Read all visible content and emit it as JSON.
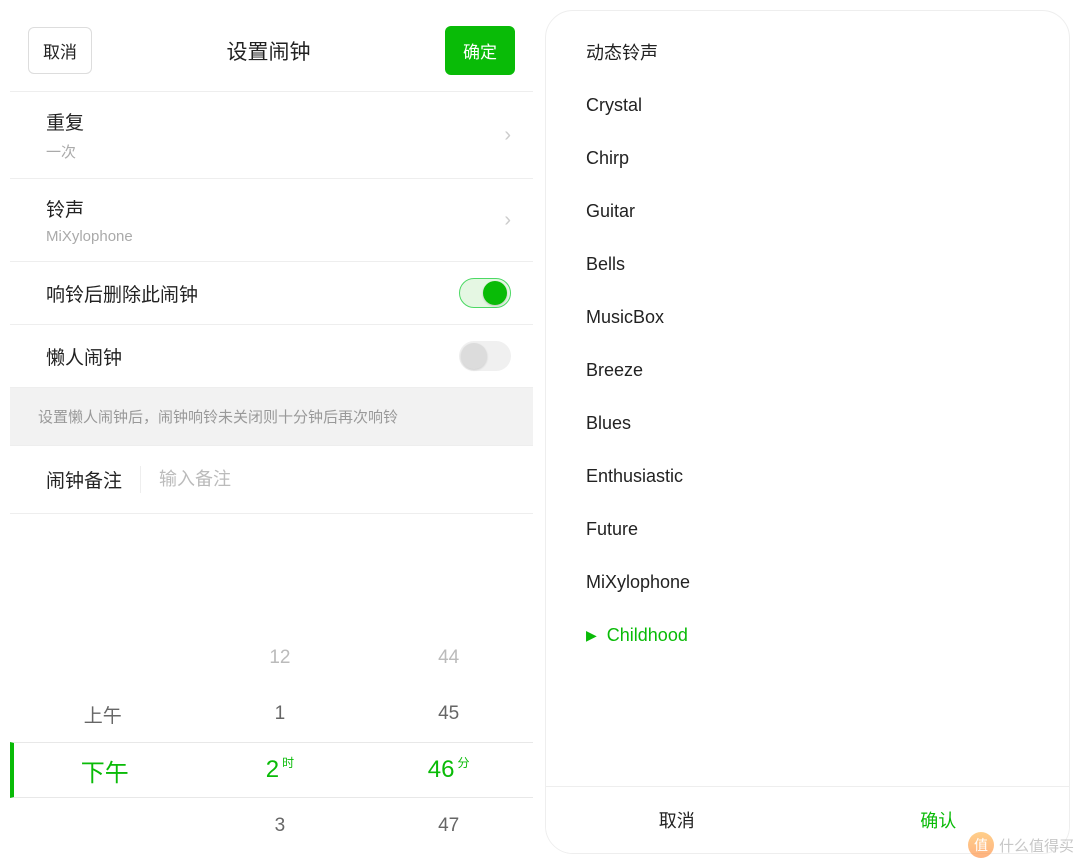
{
  "colors": {
    "accent": "#09bb07"
  },
  "left": {
    "header": {
      "cancel": "取消",
      "title": "设置闹钟",
      "ok": "确定"
    },
    "rows": {
      "repeat": {
        "title": "重复",
        "value": "一次"
      },
      "ringtone": {
        "title": "铃声",
        "value": "MiXylophone"
      },
      "delete_after": {
        "title": "响铃后删除此闹钟",
        "on": true
      },
      "lazy": {
        "title": "懒人闹钟",
        "on": false
      }
    },
    "hint": "设置懒人闹钟后，闹钟响铃未关闭则十分钟后再次响铃",
    "note": {
      "label": "闹钟备注",
      "placeholder": "输入备注",
      "value": ""
    },
    "picker": {
      "ampm": {
        "prev": "上午",
        "sel": "下午",
        "next": ""
      },
      "hour": {
        "prev2": "12",
        "prev": "1",
        "sel": "2",
        "next": "3",
        "unit": "时"
      },
      "minute": {
        "prev2": "44",
        "prev": "45",
        "sel": "46",
        "next": "47",
        "unit": "分"
      }
    }
  },
  "right": {
    "title": "动态铃声",
    "items": [
      {
        "name": "Crystal",
        "selected": false
      },
      {
        "name": "Chirp",
        "selected": false
      },
      {
        "name": "Guitar",
        "selected": false
      },
      {
        "name": "Bells",
        "selected": false
      },
      {
        "name": "MusicBox",
        "selected": false
      },
      {
        "name": "Breeze",
        "selected": false
      },
      {
        "name": "Blues",
        "selected": false
      },
      {
        "name": "Enthusiastic",
        "selected": false
      },
      {
        "name": "Future",
        "selected": false
      },
      {
        "name": "MiXylophone",
        "selected": false
      },
      {
        "name": "Childhood",
        "selected": true
      }
    ],
    "footer": {
      "cancel": "取消",
      "confirm": "确认"
    }
  },
  "watermark": {
    "badge": "值",
    "text": "什么值得买"
  }
}
